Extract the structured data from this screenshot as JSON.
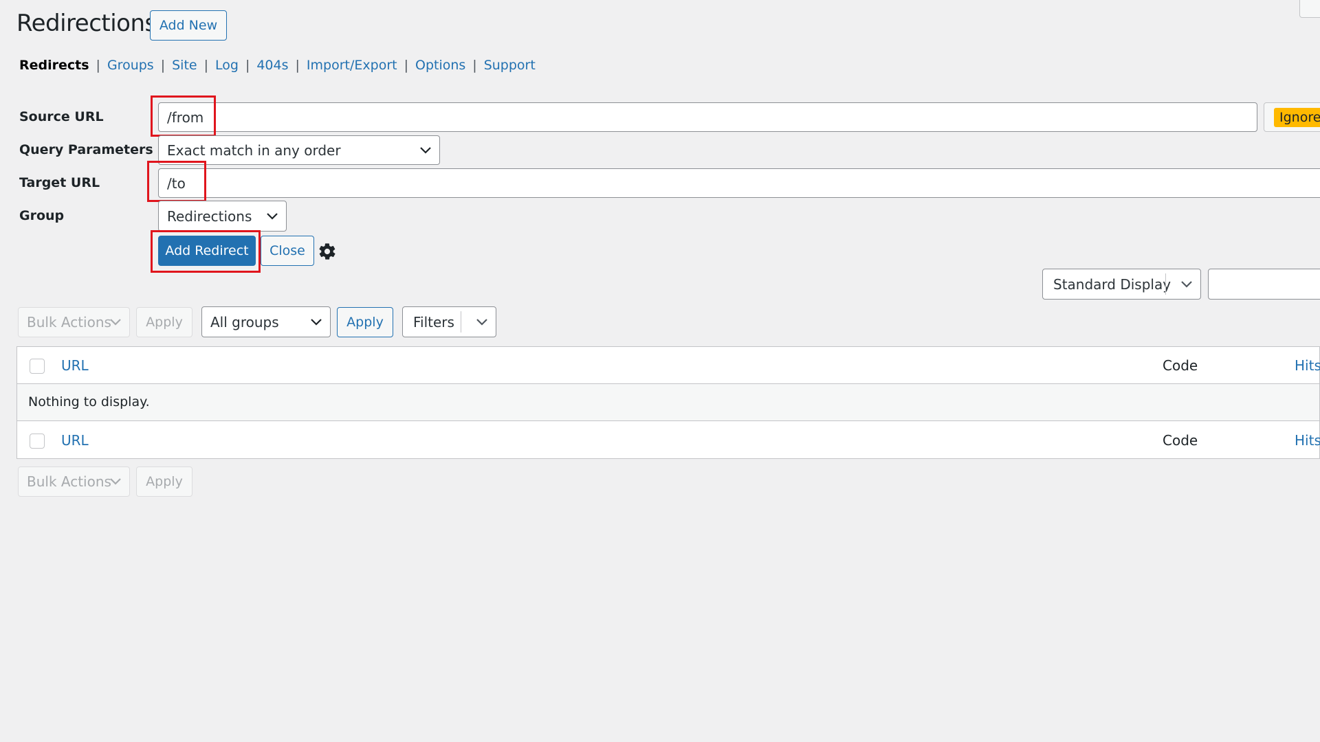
{
  "page": {
    "title": "Redirections",
    "add_new_label": "Add New"
  },
  "subnav": {
    "items": [
      "Redirects",
      "Groups",
      "Site",
      "Log",
      "404s",
      "Import/Export",
      "Options",
      "Support"
    ],
    "separator": "|",
    "current": "Redirects"
  },
  "form": {
    "source_label": "Source URL",
    "source_value": "/from",
    "ignore_label": "Ignore",
    "query_label": "Query Parameters",
    "query_value": "Exact match in any order",
    "target_label": "Target URL",
    "target_value": "/to",
    "group_label": "Group",
    "group_value": "Redirections",
    "add_redirect_label": "Add Redirect",
    "close_label": "Close"
  },
  "display": {
    "mode": "Standard Display",
    "search_value": ""
  },
  "toolbar": {
    "bulk_actions": "Bulk Actions",
    "apply": "Apply",
    "groups_select": "All groups",
    "apply_active": "Apply",
    "filters": "Filters"
  },
  "table": {
    "columns": [
      "URL",
      "Code",
      "Hits"
    ],
    "empty_message": "Nothing to display."
  },
  "bottom_toolbar": {
    "bulk_actions": "Bulk Actions",
    "apply": "Apply"
  },
  "colors": {
    "accent": "#2271b1",
    "highlight": "#e0151d",
    "warning": "#ffb900",
    "background": "#f0f0f1"
  }
}
